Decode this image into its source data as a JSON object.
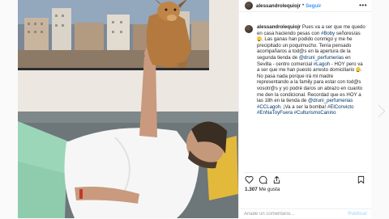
{
  "post": {
    "username": "alessandrolequiojr",
    "follow_label": "Seguir",
    "more_label": "•••",
    "caption": {
      "username": "alessandrolequiojr",
      "t1": " Pues va a ser que me quedo en casa haciendo pesas con ",
      "m1": "#Boby",
      "t2": " señores/as ",
      "t3": ". Las ganas han podido conmigo y me he precipitado un poquimucho. Tenía pensado acompañaros a tod@s en la apertura de la segunda tienda de ",
      "m2": "@druni_perfumerias",
      "t4": " en Sevilla - centro comercial ",
      "m3": "#Lagoh",
      "t5": " - HOY pero va a ser que me han puesto arresto domiciliario ",
      "t6": ". No pasa nada porque irá mi madre representando a la family para estar con tod@s vosotr@s y yo podré daros un abrazo en cuanto me den la condicional. Recordad que es HOY a las 18h en la tienda de ",
      "m4": "@druni_perfumerias",
      "m5": "#CCLagoh",
      "t7": ". ¡Va a ser la bomba! ",
      "m6": "#ElConvicto",
      "m7": "#EnNaToyFuera",
      "m8": "#CulturismoCanino"
    },
    "likes_count": "1.307",
    "likes_label": "Me gusta",
    "comment_placeholder": "Añade un comentario...",
    "publish_label": "Publicar"
  },
  "colors": {
    "accent": "#3897f0",
    "hashtag": "#003569",
    "publish_disabled": "#b2dffc",
    "text": "#262626"
  },
  "icons": {
    "like": "heart-icon",
    "comment": "comment-icon",
    "share": "share-icon",
    "save": "bookmark-icon",
    "more": "more-options-icon"
  }
}
